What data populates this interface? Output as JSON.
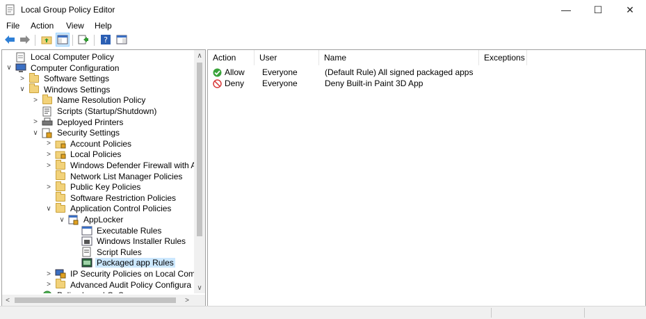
{
  "window": {
    "title": "Local Group Policy Editor",
    "minimize": "—",
    "maximize": "☐",
    "close": "✕"
  },
  "menu": [
    "File",
    "Action",
    "View",
    "Help"
  ],
  "toolbar": {
    "back": "◀",
    "forward": "▶",
    "up": "▲",
    "help": "?"
  },
  "tree": [
    {
      "label": "Local Computer Policy",
      "icon": "policy-doc-icon",
      "expander": ""
    },
    {
      "label": "Computer Configuration",
      "icon": "computer-icon",
      "expander": "∨"
    },
    {
      "label": "Software Settings",
      "icon": "folder-icon",
      "expander": ">"
    },
    {
      "label": "Windows Settings",
      "icon": "folder-icon",
      "expander": "∨"
    },
    {
      "label": "Name Resolution Policy",
      "icon": "folder-icon",
      "expander": ">"
    },
    {
      "label": "Scripts (Startup/Shutdown)",
      "icon": "script-icon",
      "expander": ""
    },
    {
      "label": "Deployed Printers",
      "icon": "printer-icon",
      "expander": ">"
    },
    {
      "label": "Security Settings",
      "icon": "security-settings-icon",
      "expander": "∨"
    },
    {
      "label": "Account Policies",
      "icon": "locked-folder-icon",
      "expander": ">"
    },
    {
      "label": "Local Policies",
      "icon": "locked-folder-icon",
      "expander": ">"
    },
    {
      "label": "Windows Defender Firewall with A",
      "icon": "folder-icon",
      "expander": ">"
    },
    {
      "label": "Network List Manager Policies",
      "icon": "folder-icon",
      "expander": ""
    },
    {
      "label": "Public Key Policies",
      "icon": "folder-icon",
      "expander": ">"
    },
    {
      "label": "Software Restriction Policies",
      "icon": "folder-icon",
      "expander": ""
    },
    {
      "label": "Application Control Policies",
      "icon": "folder-icon",
      "expander": "∨"
    },
    {
      "label": "AppLocker",
      "icon": "applocker-icon",
      "expander": "∨"
    },
    {
      "label": "Executable Rules",
      "icon": "rules-icon",
      "expander": ""
    },
    {
      "label": "Windows Installer Rules",
      "icon": "installer-rules-icon",
      "expander": ""
    },
    {
      "label": "Script Rules",
      "icon": "script-rules-icon",
      "expander": ""
    },
    {
      "label": "Packaged app Rules",
      "icon": "packaged-app-rules-icon",
      "expander": ""
    },
    {
      "label": "IP Security Policies on Local Com",
      "icon": "ip-security-icon",
      "expander": ">"
    },
    {
      "label": "Advanced Audit Policy Configura",
      "icon": "folder-icon",
      "expander": ">"
    },
    {
      "label": "Policy-based QoS",
      "icon": "qos-icon",
      "expander": ">"
    }
  ],
  "scroll": {
    "up": "∧",
    "down": "∨",
    "left": "<",
    "right": ">"
  },
  "list": {
    "columns": [
      "Action",
      "User",
      "Name",
      "Exceptions"
    ],
    "rows": [
      {
        "action": "Allow",
        "action_icon": "allow-check-icon",
        "user": "Everyone",
        "name": "(Default Rule) All signed packaged apps",
        "exceptions": ""
      },
      {
        "action": "Deny",
        "action_icon": "deny-circle-icon",
        "user": "Everyone",
        "name": "Deny Built-in Paint 3D App",
        "exceptions": ""
      }
    ]
  },
  "colors": {
    "selection": "#cce8ff",
    "allow": "#3aa33a",
    "deny": "#d83b3b",
    "folder": "#f2d27a"
  }
}
